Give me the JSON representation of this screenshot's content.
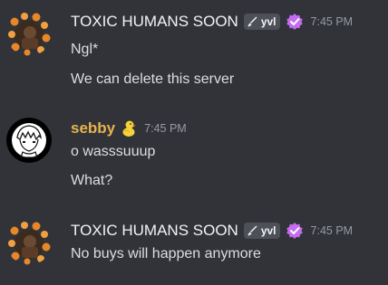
{
  "messages": [
    {
      "author": "TOXIC HUMANS SOON",
      "tag": "yvl",
      "time": "7:45 PM",
      "lines": [
        "Ngl*",
        "We can delete this server"
      ]
    },
    {
      "author": "sebby",
      "time": "7:45 PM",
      "lines": [
        "o wasssuuup",
        "What?"
      ]
    },
    {
      "author": "TOXIC HUMANS SOON",
      "tag": "yvl",
      "time": "7:45 PM",
      "lines": [
        "No buys will happen anymore"
      ]
    }
  ],
  "colors": {
    "background": "#313338",
    "message_text": "#dbdee1",
    "timestamp": "#949ba4",
    "gold_name": "#e8b44c",
    "verify_badge": "#c56cf0",
    "tag_bg": "#4e5058"
  },
  "icons": [
    "sword-icon",
    "verified-badge-icon",
    "duck-emoji-icon",
    "orange-avatar",
    "anime-avatar"
  ]
}
